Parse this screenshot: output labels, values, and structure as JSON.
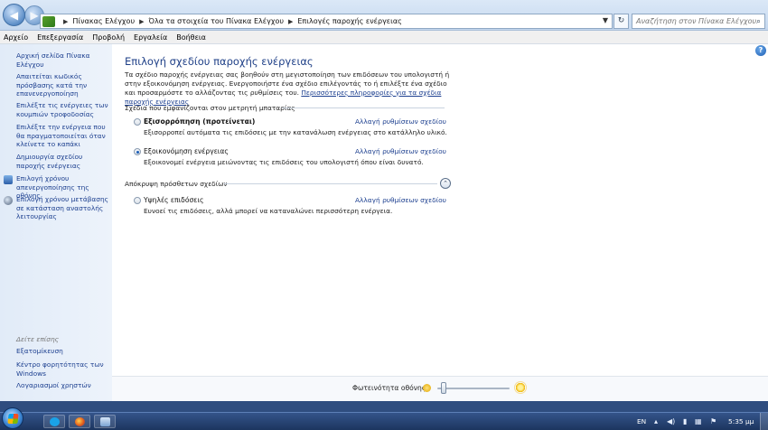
{
  "address_bar": {
    "breadcrumbs": [
      "Πίνακας Ελέγχου",
      "Όλα τα στοιχεία του Πίνακα Ελέγχου",
      "Επιλογές παροχής ενέργειας"
    ],
    "search_placeholder": "Αναζήτηση στον Πίνακα Ελέγχου"
  },
  "menu": [
    "Αρχείο",
    "Επεξεργασία",
    "Προβολή",
    "Εργαλεία",
    "Βοήθεια"
  ],
  "sidebar": {
    "home": "Αρχική σελίδα Πίνακα Ελέγχου",
    "items": [
      "Απαιτείται κωδικός πρόσβασης κατά την επανενεργοποίηση",
      "Επιλέξτε τις ενέργειες των κουμπιών τροφοδοσίας",
      "Επιλέξτε την ενέργεια που θα πραγματοποιείται όταν κλείνετε το καπάκι",
      "Δημιουργία σχεδίου παροχής ενέργειας",
      "Επιλογή χρόνου απενεργοποίησης της οθόνης",
      "Επιλογή χρόνου μετάβασης σε κατάσταση αναστολής λειτουργίας"
    ],
    "see_also_label": "Δείτε επίσης",
    "see_also": [
      "Εξατομίκευση",
      "Κέντρο φορητότητας των Windows",
      "Λογαριασμοί χρηστών"
    ]
  },
  "main": {
    "title": "Επιλογή σχεδίου παροχής ενέργειας",
    "intro": "Τα σχέδιο παροχής ενέργειας σας βοηθούν στη μεγιστοποίηση των επιδόσεων του υπολογιστή ή στην εξοικονόμηση ενέργειας. Ενεργοποιήστε ένα σχέδιο επιλέγοντάς το ή επιλέξτε ένα σχέδιο και προσαρμόστε το αλλάζοντας τις ρυθμίσεις του.",
    "more_info_link": "Περισσότερες πληροφορίες για τα σχέδια παροχής ενέργειας",
    "battery_group_label": "Σχέδια που εμφανίζονται στον μετρητή μπαταρίας",
    "plans": [
      {
        "name": "Εξισορρόπηση (προτείνεται)",
        "description": "Εξισορροπεί αυτόματα τις επιδόσεις με την κατανάλωση ενέργειας στο κατάλληλο υλικό.",
        "link": "Αλλαγή ρυθμίσεων σχεδίου",
        "selected": false
      },
      {
        "name": "Εξοικονόμηση ενέργειας",
        "description": "Εξοικονομεί ενέργεια μειώνοντας τις επιδόσεις του υπολογιστή όπου είναι δυνατό.",
        "link": "Αλλαγή ρυθμίσεων σχεδίου",
        "selected": true
      }
    ],
    "hide_additional_label": "Απόκρυψη πρόσθετων σχεδίων",
    "additional_plans": [
      {
        "name": "Υψηλές επιδόσεις",
        "description": "Ευνοεί τις επιδόσεις, αλλά μπορεί να καταναλώνει περισσότερη ενέργεια.",
        "link": "Αλλαγή ρυθμίσεων σχεδίου",
        "selected": false
      }
    ],
    "brightness_label": "Φωτεινότητα οθόνης:",
    "brightness_level": 0.05
  },
  "taskbar": {
    "language": "EN",
    "time": "5:35 μμ"
  }
}
